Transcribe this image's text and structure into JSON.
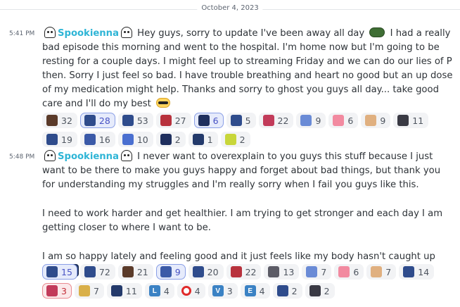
{
  "date_divider": "October 4, 2023",
  "messages": [
    {
      "time": "5:41 PM",
      "username": "Spookienna",
      "text_1": "Hey guys, sorry to update I've been away all day",
      "text_2": "I had a really bad episode this morning and went to the hospital. I'm home now but I'm going to be resting for a couple days. I might feel up to streaming Friday and we can do our lies of P then. Sorry I just feel so bad. I have trouble breathing and heart no good but an up dose of my medication might help. Thanks and sorry to ghost you guys all day... take good care and I'll do my best",
      "reactions_row1": [
        {
          "icon": "anime-emote-icon",
          "color": "#5b3b2a",
          "count": "32"
        },
        {
          "icon": "anime-emote-icon",
          "color": "#2f4c8c",
          "count": "28",
          "me": true
        },
        {
          "icon": "anime-emote-icon",
          "color": "#2f4c8c",
          "count": "53"
        },
        {
          "icon": "anime-emote-icon",
          "color": "#b8323d",
          "count": "27"
        },
        {
          "icon": "anime-emote-icon",
          "color": "#1f2f5e",
          "count": "6",
          "me": true
        },
        {
          "icon": "anime-emote-icon",
          "color": "#2f4c8c",
          "count": "5"
        },
        {
          "icon": "anime-emote-icon",
          "color": "#c23b5a",
          "count": "22"
        },
        {
          "icon": "anime-emote-icon",
          "color": "#6a8bd6",
          "count": "9"
        },
        {
          "icon": "cake-emote-icon",
          "color": "#f28aa0",
          "count": "6"
        },
        {
          "icon": "animal-emote-icon",
          "color": "#e0b080",
          "count": "9"
        },
        {
          "icon": "anime-emote-icon",
          "color": "#3a3a44",
          "count": "11"
        }
      ],
      "reactions_row2": [
        {
          "icon": "anime-emote-icon",
          "color": "#2f4c8c",
          "count": "19"
        },
        {
          "icon": "anime-emote-icon",
          "color": "#3b5aa8",
          "count": "16"
        },
        {
          "icon": "anime-emote-icon",
          "color": "#4a6fd0",
          "count": "10"
        },
        {
          "icon": "anime-emote-icon",
          "color": "#1f2f5e",
          "count": "2"
        },
        {
          "icon": "anime-emote-icon",
          "color": "#243a6b",
          "count": "1"
        },
        {
          "icon": "fruit-emote-icon",
          "color": "#c8d63a",
          "count": "2"
        }
      ]
    },
    {
      "time": "5:48 PM",
      "username": "Spookienna",
      "para_1": "I never want to overexplain to you guys this stuff because I just want to be there to make you guys happy and forget about bad things, but thank you for understanding my struggles and I'm really sorry when I fail you guys like this.",
      "para_2": "I need to work harder and get healthier. I am trying to get stronger and each day I am getting closer to where I want to be.",
      "para_3": "I am so happy lately and feeling good and it just feels like my body hasn't caught up yet.",
      "reactions_row1": [
        {
          "icon": "anime-emote-icon",
          "color": "#2f4c8c",
          "count": "15",
          "me": true
        },
        {
          "icon": "anime-emote-icon",
          "color": "#2f4c8c",
          "count": "72"
        },
        {
          "icon": "anime-emote-icon",
          "color": "#5b3b2a",
          "count": "21"
        },
        {
          "icon": "anime-emote-icon",
          "color": "#3b5aa8",
          "count": "9",
          "me": true
        },
        {
          "icon": "anime-emote-icon",
          "color": "#2f4c8c",
          "count": "20"
        },
        {
          "icon": "anime-emote-icon",
          "color": "#b8323d",
          "count": "22"
        },
        {
          "icon": "anime-emote-icon",
          "color": "#5c5c66",
          "count": "13"
        },
        {
          "icon": "anime-emote-icon",
          "color": "#6a8bd6",
          "count": "7"
        },
        {
          "icon": "cake-emote-icon",
          "color": "#f28aa0",
          "count": "6"
        },
        {
          "icon": "animal-emote-icon",
          "color": "#e0b080",
          "count": "7"
        },
        {
          "icon": "anime-emote-icon",
          "color": "#2f4c8c",
          "count": "14"
        }
      ],
      "reactions_row2": [
        {
          "icon": "anime-emote-icon",
          "color": "#c23b5a",
          "count": "3",
          "me_red": true
        },
        {
          "icon": "animal-emote-icon",
          "color": "#d9b04a",
          "count": "7"
        },
        {
          "icon": "anime-emote-icon",
          "color": "#243a6b",
          "count": "11"
        },
        {
          "icon": "letter-l-icon",
          "color": "#3b82c4",
          "letter": "L",
          "count": "4"
        },
        {
          "icon": "red-circle-icon",
          "color": "#e02a2a",
          "count": "4"
        },
        {
          "icon": "letter-v-icon",
          "color": "#3b82c4",
          "letter": "V",
          "count": "3"
        },
        {
          "icon": "letter-e-icon",
          "color": "#3b82c4",
          "letter": "E",
          "count": "4"
        },
        {
          "icon": "anime-emote-icon",
          "color": "#2f4c8c",
          "count": "2"
        },
        {
          "icon": "anime-emote-icon",
          "color": "#3a3a44",
          "count": "2"
        }
      ]
    }
  ]
}
